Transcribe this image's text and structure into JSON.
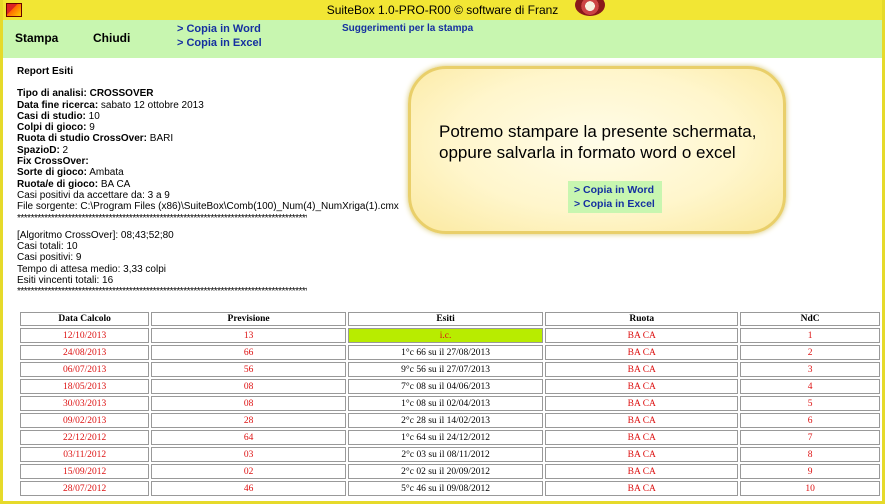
{
  "window": {
    "title": "SuiteBox 1.0-PRO-R00   © software di Franz"
  },
  "toolbar": {
    "print_label": "Stampa",
    "close_label": "Chiudi",
    "copy_word": "> Copia in Word",
    "copy_excel": "> Copia in Excel",
    "print_tips": "Suggerimenti per la stampa"
  },
  "report": {
    "heading": "Report Esiti",
    "fields": [
      {
        "label": "Tipo di analisi:",
        "value": " CROSSOVER",
        "value_bold": true
      },
      {
        "label": "Data fine ricerca:",
        "value": " sabato 12 ottobre 2013"
      },
      {
        "label": "Casi di studio:",
        "value": " 10"
      },
      {
        "label": "Colpi di gioco:",
        "value": " 9"
      },
      {
        "label": "Ruota di studio CrossOver:",
        "value": " BARI"
      },
      {
        "label": "SpazioD:",
        "value": " 2"
      },
      {
        "label": "Fix CrossOver:",
        "value": ""
      },
      {
        "label": "Sorte di gioco:",
        "value": " Ambata"
      },
      {
        "label": "Ruota/e di gioco:",
        "value": " BA CA"
      }
    ],
    "positivi_range": "Casi positivi da accettare da: 3 a 9",
    "file_sorgente": "File sorgente: C:\\Program Files (x86)\\SuiteBox\\Comb(100)_Num(4)_NumXriga(1).cmx",
    "separator": "****************************************************************************************************",
    "algoritmo": "[Algoritmo CrossOver]: 08;43;52;80",
    "casi_totali": "Casi totali: 10",
    "casi_positivi": "Casi positivi: 9",
    "tempo_attesa": "Tempo di attesa medio: 3,33 colpi",
    "esiti_vincenti": "Esiti vincenti totali: 16"
  },
  "callout": {
    "message": "Potremo stampare la presente schermata, oppure salvarla in formato word o excel",
    "copy_word": "> Copia in Word",
    "copy_excel": "> Copia in Excel"
  },
  "table": {
    "columns": [
      "Data Calcolo",
      "Previsione",
      "Esiti",
      "Ruota",
      "NdC"
    ],
    "rows": [
      {
        "data": "12/10/2013",
        "previsione": "13",
        "esiti": "i.c.",
        "ruota": "BA CA",
        "ndc": "1",
        "highlight": true
      },
      {
        "data": "24/08/2013",
        "previsione": "66",
        "esiti": "1°c 66 su il 27/08/2013",
        "ruota": "BA CA",
        "ndc": "2"
      },
      {
        "data": "06/07/2013",
        "previsione": "56",
        "esiti": "9°c 56 su il 27/07/2013",
        "ruota": "BA CA",
        "ndc": "3"
      },
      {
        "data": "18/05/2013",
        "previsione": "08",
        "esiti": "7°c 08 su il 04/06/2013",
        "ruota": "BA CA",
        "ndc": "4"
      },
      {
        "data": "30/03/2013",
        "previsione": "08",
        "esiti": "1°c 08 su il 02/04/2013",
        "ruota": "BA CA",
        "ndc": "5"
      },
      {
        "data": "09/02/2013",
        "previsione": "28",
        "esiti": "2°c 28 su il 14/02/2013",
        "ruota": "BA CA",
        "ndc": "6"
      },
      {
        "data": "22/12/2012",
        "previsione": "64",
        "esiti": "1°c 64 su il 24/12/2012",
        "ruota": "BA CA",
        "ndc": "7"
      },
      {
        "data": "03/11/2012",
        "previsione": "03",
        "esiti": "2°c 03 su il 08/11/2012",
        "ruota": "BA CA",
        "ndc": "8"
      },
      {
        "data": "15/09/2012",
        "previsione": "02",
        "esiti": "2°c 02 su il 20/09/2012",
        "ruota": "BA CA",
        "ndc": "9"
      },
      {
        "data": "28/07/2012",
        "previsione": "46",
        "esiti": "5°c 46 su il 09/08/2012",
        "ruota": "BA CA",
        "ndc": "10"
      }
    ]
  }
}
